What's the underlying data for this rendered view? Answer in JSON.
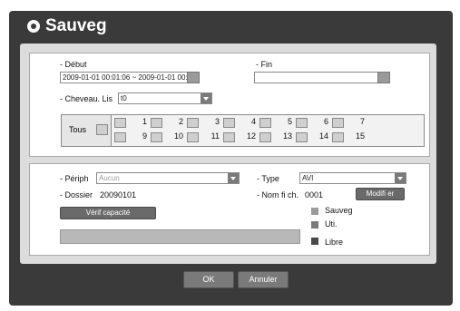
{
  "window": {
    "title": "Sauveg"
  },
  "period": {
    "debut_label": "- Début",
    "fin_label": "- Fin",
    "debut_value": "2009-01-01 00:01:06  ~  2009-01-01 00:25:46",
    "fin_value": ""
  },
  "channels": {
    "label": "- Cheveau. Lis",
    "list_value": "t0",
    "tous_label": "Tous",
    "numbers": [
      "1",
      "2",
      "3",
      "4",
      "5",
      "6",
      "7",
      "9",
      "10",
      "11",
      "12",
      "13",
      "14",
      "15"
    ]
  },
  "device": {
    "periph_label": "- Périph",
    "periph_value": "Aucun",
    "type_label": "- Type",
    "type_value": "AVI",
    "dossier_label": "- Dossier",
    "dossier_value": "20090101",
    "nom_label": "- Nom fi ch.",
    "nom_value": "0001",
    "modifier_label": "Modifi er",
    "verif_label": "Vérif capacité"
  },
  "legend": {
    "items": [
      {
        "label": "Sauveg",
        "color": "#9a9a9a"
      },
      {
        "label": "Uti.",
        "color": "#7a7a7a"
      },
      {
        "label": "Libre",
        "color": "#4a4a4a"
      }
    ]
  },
  "buttons": {
    "ok": "OK",
    "annuler": "Annuler"
  },
  "colors": {
    "frame": "#3a3a3a",
    "panel": "#dcdcdc",
    "button": "#7a7a7a"
  }
}
